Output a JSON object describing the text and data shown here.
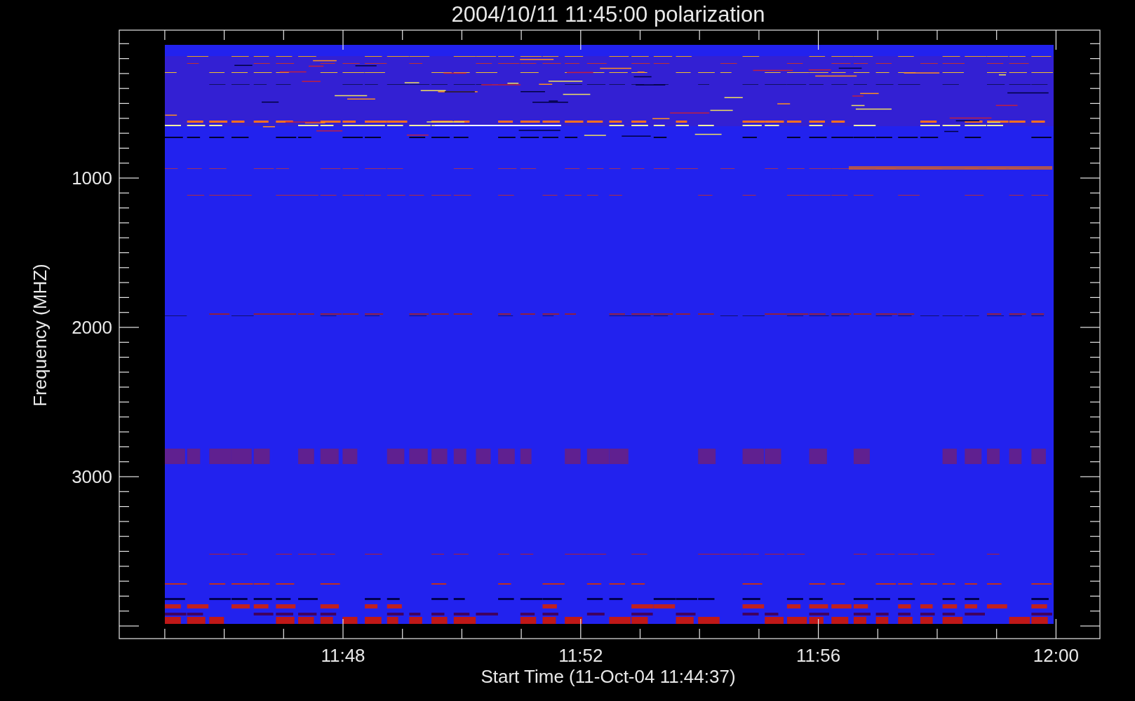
{
  "title": "2004/10/11 11:45:00 polarization",
  "y_axis": {
    "label": "Frequency (MHZ)",
    "ticks": [
      "1000",
      "2000",
      "3000"
    ]
  },
  "x_axis": {
    "label": "Start Time (11-Oct-04 11:44:37)",
    "ticks": [
      "11:48",
      "11:52",
      "11:56",
      "12:00"
    ]
  }
}
